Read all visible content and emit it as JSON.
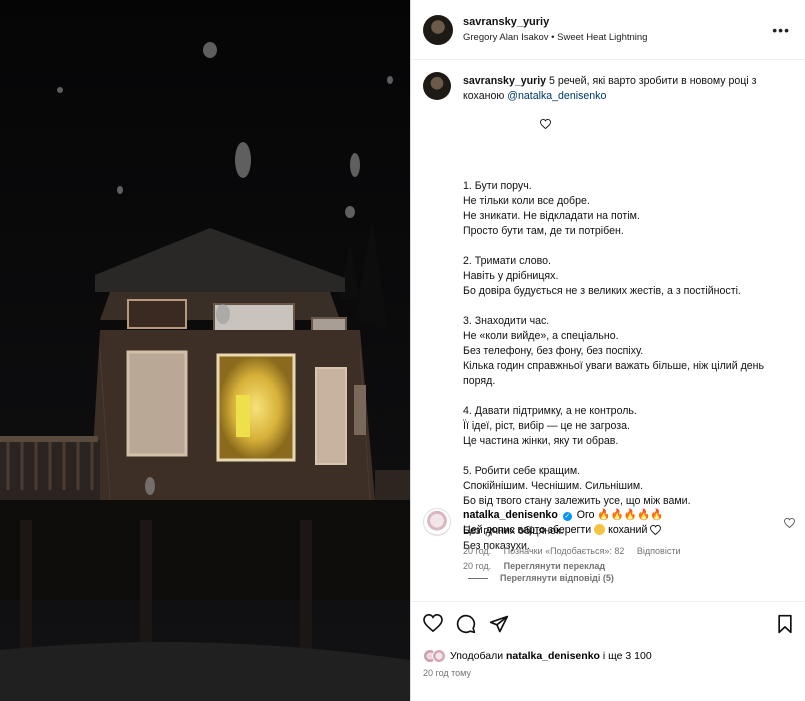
{
  "post": {
    "username": "savransky_yuriy",
    "song": "Gregory Alan Isakov • Sweet Heat Lightning",
    "more_icon": "more-horizontal-icon"
  },
  "caption": {
    "username": "savransky_yuriy",
    "intro": " 5 речей, які варто зробити в новому році з коханою ",
    "mention": "@natalka_denisenko",
    "heart_icon": "heart-outline-icon",
    "paragraphs": [
      "1. Бути поруч.\nНе тільки коли все добре.\nНе зникати. Не відкладати на потім.\nПросто бути там, де ти потрібен.",
      "2. Тримати слово.\nНавіть у дрібницях.\nБо довіра будується не з великих жестів, а з постійності.",
      "3. Знаходити час.\nНе «коли вийде», а спеціально.\nБез телефону, без фону, без поспіху.\nКілька годин справжньої уваги важать більше, ніж цілий день поряд.",
      "4. Давати підтримку, а не контроль.\nЇї ідеї, ріст, вибір — це не загроза.\nЦе частина жінки, яку ти обрав.",
      "5. Робити себе кращим.\nСпокійнішим. Чеснішим. Сильнішим.\nБо від твого стану залежить усе, що між вами.",
      "Без гучних обіцянок.\nБез показухи."
    ],
    "time": "20 год.",
    "see_translation": "Переглянути переклад"
  },
  "comment": {
    "username": "natalka_denisenko",
    "verified_icon": "verified-badge-icon",
    "line1_text": "Ого 🔥🔥🔥🔥🔥",
    "line2_start": "Цей допис варто зберегти",
    "line2_end": " коханий ",
    "time": "20 год.",
    "likes": "Позначки «Подобається»: 82",
    "reply": "Відповісти",
    "view_replies": "Переглянути відповіді (5)"
  },
  "actions": {
    "like_icon": "heart-icon",
    "comment_icon": "comment-icon",
    "share_icon": "share-icon",
    "save_icon": "bookmark-icon",
    "likes_prefix": "Уподобали ",
    "likes_user": "natalka_denisenko",
    "likes_suffix": " і ще 3 100",
    "time": "20 год тому"
  }
}
